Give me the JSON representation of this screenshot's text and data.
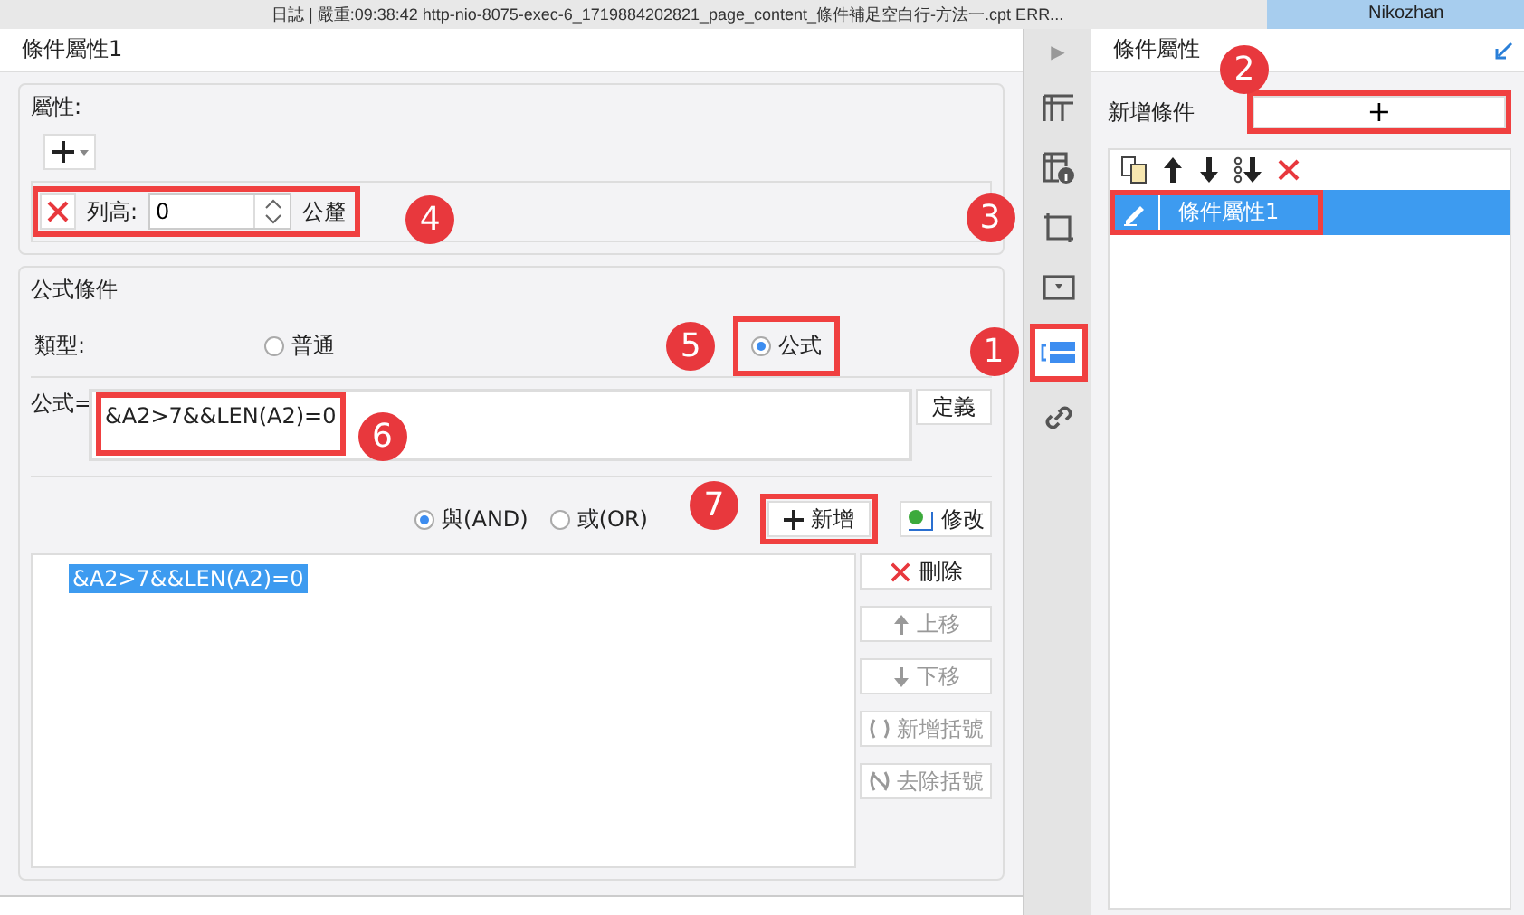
{
  "top_bar": {
    "log_text": "日誌 | 嚴重:09:38:42 http-nio-8075-exec-6_1719884202821_page_content_條件補足空白行-方法一.cpt ERR...",
    "user": "Nikozhan"
  },
  "left_panel": {
    "title": "條件屬性1",
    "attributes": {
      "legend": "屬性:",
      "row": {
        "label": "列高:",
        "value": "0",
        "unit": "公釐"
      }
    },
    "formula_condition": {
      "legend": "公式條件",
      "type_label": "類型:",
      "types": [
        {
          "label": "普通",
          "selected": false
        },
        {
          "label": "公式",
          "selected": true
        }
      ],
      "formula_label": "公式=",
      "formula_value": "&A2>7&&LEN(A2)=0",
      "define_button": "定義",
      "logic": [
        {
          "label": "與(AND)",
          "selected": true
        },
        {
          "label": "或(OR)",
          "selected": false
        }
      ],
      "add_button": "新增",
      "modify_button": "修改",
      "conditions": [
        {
          "text": "&A2>7&&LEN(A2)=0",
          "selected": true
        }
      ],
      "side_buttons": [
        {
          "kind": "delete",
          "label": "刪除",
          "disabled": false
        },
        {
          "kind": "up",
          "label": "上移",
          "disabled": true
        },
        {
          "kind": "down",
          "label": "下移",
          "disabled": true
        },
        {
          "kind": "add_bracket",
          "label": "新增括號",
          "disabled": true
        },
        {
          "kind": "remove_bracket",
          "label": "去除括號",
          "disabled": true
        }
      ]
    }
  },
  "icon_bar": {
    "expand": "▶",
    "items": [
      {
        "kind": "grid",
        "selected": false
      },
      {
        "kind": "info",
        "selected": false
      },
      {
        "kind": "frame",
        "selected": false
      },
      {
        "kind": "dropdown",
        "selected": false
      },
      {
        "kind": "condition",
        "selected": true
      },
      {
        "kind": "link",
        "selected": false
      }
    ]
  },
  "right_panel": {
    "title": "條件屬性",
    "add_label": "新增條件",
    "add_button": "+",
    "items": [
      {
        "label": "條件屬性1",
        "selected": true
      }
    ]
  },
  "annotations": [
    {
      "number": "1"
    },
    {
      "number": "2"
    },
    {
      "number": "3"
    },
    {
      "number": "4"
    },
    {
      "number": "5"
    },
    {
      "number": "6"
    },
    {
      "number": "7"
    }
  ]
}
